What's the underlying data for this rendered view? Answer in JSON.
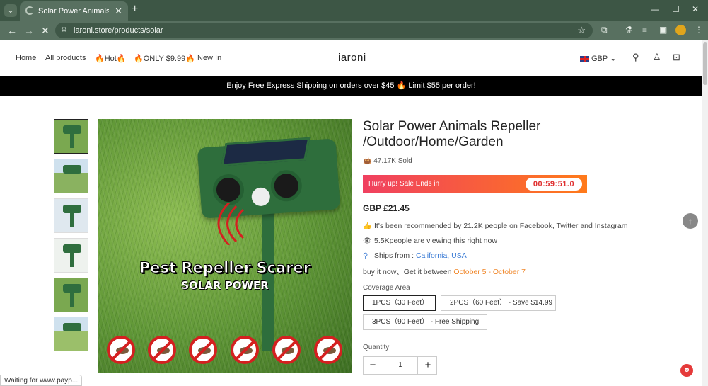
{
  "browser": {
    "tab_title": "Solar Power Animals Repeller /",
    "url": "iaroni.store/products/solar",
    "status_text": "Waiting for www.payp..."
  },
  "header": {
    "nav": [
      "Home",
      "All products",
      "Hot",
      "ONLY $9.99",
      "New In"
    ],
    "brand": "iaroni",
    "currency": "GBP"
  },
  "announcement": {
    "text_before": "Enjoy Free Express Shipping on orders over $45",
    "text_after": "Limit $55 per order!"
  },
  "product": {
    "image_caption_1": "Pest Repeller Scarer",
    "image_caption_2": "SOLAR POWER",
    "title": "Solar Power Animals Repeller /Outdoor/Home/Garden",
    "sold": "47.17K Sold",
    "sale_text": "Hurry up! Sale Ends in",
    "countdown": "00:59:51.0",
    "price": "GBP £21.45",
    "recommended": "It's been recommended by 21.2K people on Facebook, Twitter and Instagram",
    "viewing": "5.5Kpeople are viewing this right now",
    "ships_from_label": "Ships from :",
    "ships_from_value": "California, USA",
    "delivery_prefix": "buy it now、Get it between",
    "delivery_start": "October 5",
    "delivery_sep": "-",
    "delivery_end": "October 7",
    "coverage_label": "Coverage Area",
    "options": [
      {
        "label": "1PCS（30 Feet）"
      },
      {
        "label": "2PCS（60 Feet） - Save $14.99"
      },
      {
        "label": "3PCS（90 Feet） - Free Shipping"
      }
    ],
    "quantity_label": "Quantity",
    "quantity": "1"
  }
}
